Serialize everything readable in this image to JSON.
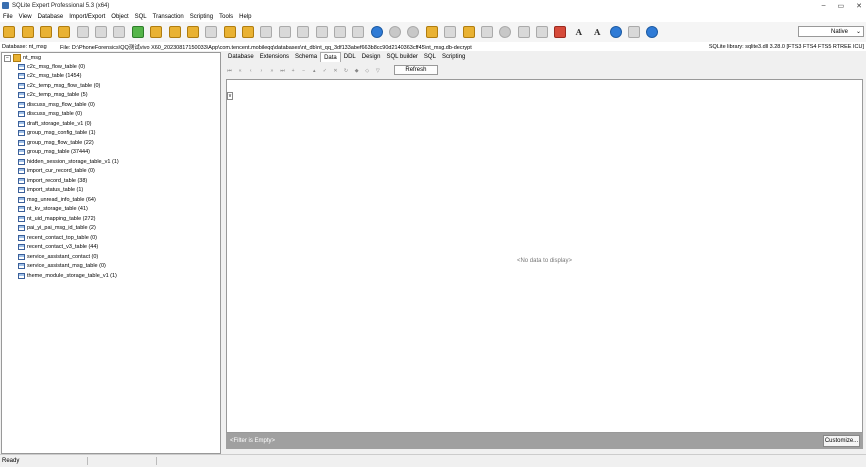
{
  "window": {
    "title": "SQLite Expert Professional 5.3 (x64)"
  },
  "menu": [
    "File",
    "View",
    "Database",
    "Import/Export",
    "Object",
    "SQL",
    "Transaction",
    "Scripting",
    "Tools",
    "Help"
  ],
  "toolbar": {
    "mode_select": "Native"
  },
  "info": {
    "database": "Database: nt_msg",
    "file": "File: D:\\PhoneForensics\\QQ测试vivo X60_20230817150033\\App\\com.tencent.mobileqq\\databases\\nt_db\\nt_qq_3df133abef663b8cc90d2140363cff45\\nt_msg.db-decrypt",
    "library": "SQLite library: sqlite3.dll 3.28.0 [FTS3 FTS4 FTS5 RTREE ICU]"
  },
  "tree": {
    "root": "nt_msg",
    "items": [
      "c2c_msg_flow_table (0)",
      "c2c_msg_table (1454)",
      "c2c_temp_msg_flow_table (0)",
      "c2c_temp_msg_table (5)",
      "discuss_msg_flow_table (0)",
      "discuss_msg_table (0)",
      "draft_storage_table_v1 (0)",
      "group_msg_config_table (1)",
      "group_msg_flow_table (22)",
      "group_msg_table (37444)",
      "hidden_session_storage_table_v1 (1)",
      "import_cur_record_table (0)",
      "import_record_table (38)",
      "import_status_table (1)",
      "msg_unread_info_table (64)",
      "nt_kv_storage_table (41)",
      "nt_uid_mapping_table (272)",
      "pai_yi_pai_msg_id_table (2)",
      "recent_contact_top_table (0)",
      "recent_contact_v3_table (44)",
      "service_assistant_contact (0)",
      "service_assistant_msg_table (0)",
      "theme_module_storage_table_v1 (1)"
    ]
  },
  "tabs": [
    "Database",
    "Extensions",
    "Schema",
    "Data",
    "DDL",
    "Design",
    "SQL builder",
    "SQL",
    "Scripting"
  ],
  "active_tab": "Data",
  "grid": {
    "refresh_label": "Refresh",
    "empty_message": "<No data to display>",
    "filter_text": "<Filter is Empty>",
    "customize_label": "Customize..."
  },
  "status": {
    "text": "Ready"
  }
}
